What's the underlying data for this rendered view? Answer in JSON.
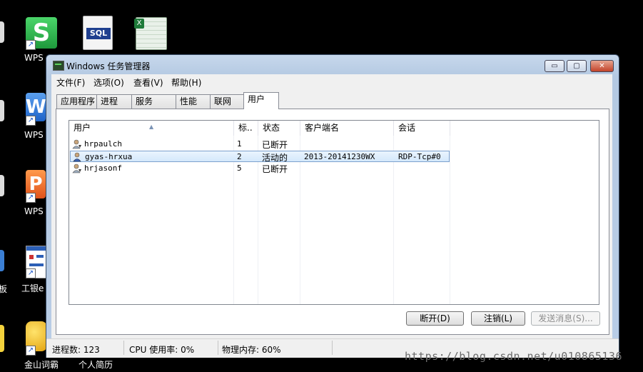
{
  "desktop": {
    "icons": [
      {
        "label": "WPS"
      },
      {
        "label": "WPS"
      },
      {
        "label": "WPS"
      },
      {
        "label": "工银e"
      },
      {
        "label": "金山词霸"
      },
      {
        "label": "个人简历"
      }
    ],
    "sql_icon_text": "SQL",
    "left_edge_label": "板"
  },
  "window": {
    "title": "Windows 任务管理器",
    "caption_buttons": {
      "minimize": "▭",
      "maximize": "▢",
      "close": "✕"
    },
    "menu": [
      "文件(F)",
      "选项(O)",
      "查看(V)",
      "帮助(H)"
    ],
    "tabs": [
      "应用程序",
      "进程",
      "服务",
      "性能",
      "联网",
      "用户"
    ],
    "active_tab": "用户",
    "columns": [
      "用户",
      "标..",
      "状态",
      "客户端名",
      "会话"
    ],
    "rows": [
      {
        "user": "hrpaulch",
        "id": "1",
        "status": "已断开",
        "client": "",
        "session": ""
      },
      {
        "user": "gyas-hrxua",
        "id": "2",
        "status": "活动的",
        "client": "2013-20141230WX",
        "session": "RDP-Tcp#0"
      },
      {
        "user": "hrjasonf",
        "id": "5",
        "status": "已断开",
        "client": "",
        "session": ""
      }
    ],
    "buttons": {
      "disconnect": "断开(D)",
      "logoff": "注销(L)",
      "send_message": "发送消息(S)..."
    },
    "status": {
      "processes": "进程数: 123",
      "cpu": "CPU 使用率: 0%",
      "memory": "物理内存: 60%"
    }
  },
  "watermark": "https://blog.csdn.net/u010865136",
  "colors": {
    "selection": "#d4e8fb",
    "titlebar": "#b9cde6"
  }
}
